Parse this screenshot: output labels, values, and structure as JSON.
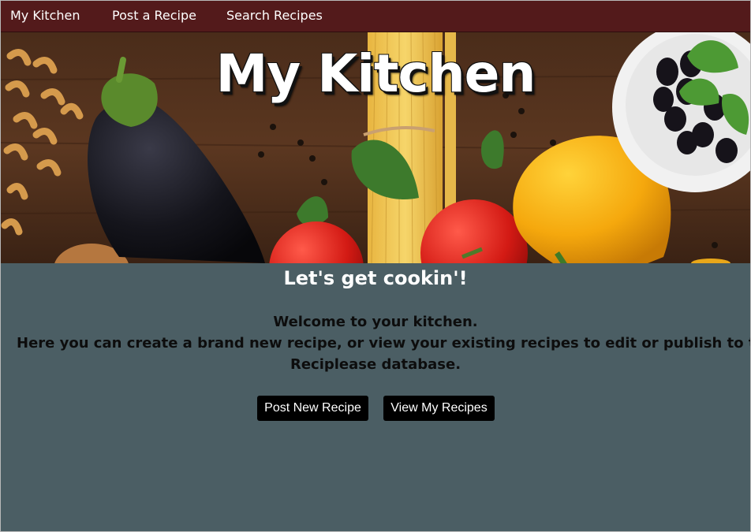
{
  "nav": {
    "items": [
      {
        "label": "My Kitchen"
      },
      {
        "label": "Post a Recipe"
      },
      {
        "label": "Search Recipes"
      }
    ]
  },
  "hero": {
    "title": "My Kitchen"
  },
  "main": {
    "heading": "Let's get cookin'!",
    "welcome_line1": "Welcome to your kitchen.",
    "welcome_line2": "Here you can create a brand new recipe, or view your existing recipes to edit or publish to the",
    "welcome_line3": "Reciplease database."
  },
  "actions": {
    "post_new_label": "Post New Recipe",
    "view_mine_label": "View My Recipes"
  },
  "colors": {
    "nav_bg": "#531a1b",
    "page_bg": "#4b5e64",
    "button_bg": "#000000"
  }
}
